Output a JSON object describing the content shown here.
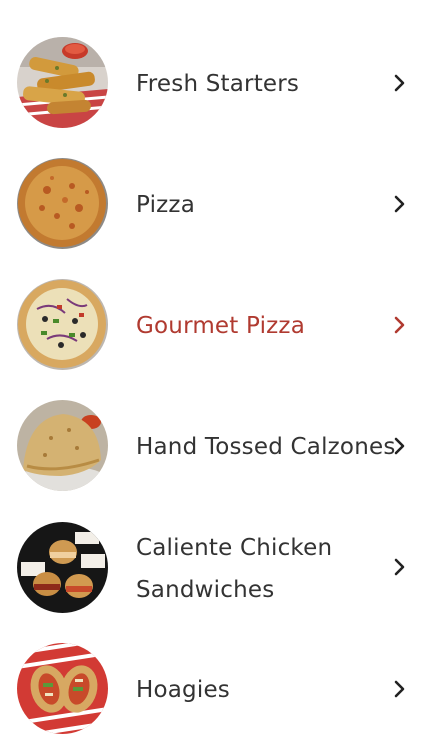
{
  "menu": {
    "categories": [
      {
        "label": "Fresh Starters",
        "image": "breadsticks-with-marinara-photo",
        "icon": "chevron-right-icon",
        "selected": false
      },
      {
        "label": "Pizza",
        "image": "cheese-pizza-photo",
        "icon": "chevron-right-icon",
        "selected": false
      },
      {
        "label": "Gourmet Pizza",
        "image": "veggie-pizza-photo",
        "icon": "chevron-right-icon",
        "selected": true
      },
      {
        "label": "Hand Tossed Calzones",
        "image": "calzone-photo",
        "icon": "chevron-right-icon",
        "selected": false
      },
      {
        "label": "Caliente Chicken Sandwiches",
        "image": "chicken-sandwiches-photo",
        "icon": "chevron-right-icon",
        "selected": false
      },
      {
        "label": "Hoagies",
        "image": "hoagie-photo",
        "icon": "chevron-right-icon",
        "selected": false
      }
    ]
  },
  "colors": {
    "text": "#333333",
    "active": "#b03a30",
    "background": "#ffffff"
  }
}
